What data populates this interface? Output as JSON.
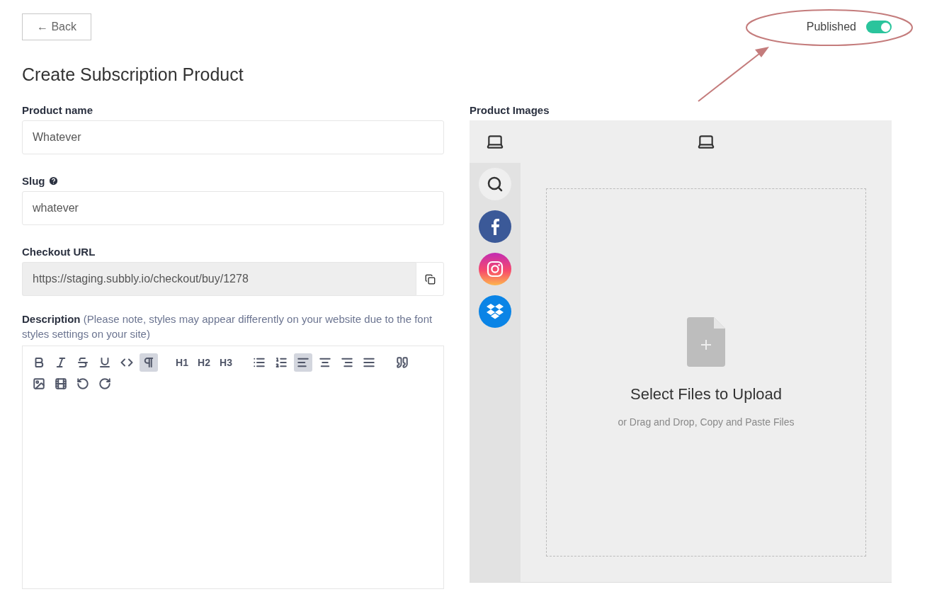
{
  "back_button": {
    "label": "← Back"
  },
  "published": {
    "label": "Published",
    "on": true
  },
  "title": "Create Subscription Product",
  "fields": [
    {
      "label": "Product name",
      "value": "Whatever",
      "help": false,
      "readonly": false
    },
    {
      "label": "Slug",
      "value": "whatever",
      "help": true,
      "readonly": false
    },
    {
      "label": "Checkout URL",
      "value": "https://staging.subbly.io/checkout/buy/1278",
      "help": false,
      "readonly": true
    }
  ],
  "description": {
    "label": "Description",
    "note": "(Please note, styles may appear differently on your website due to the font styles settings on your site)",
    "toolbar": [
      {
        "kind": "bold",
        "selected": false
      },
      {
        "kind": "italic",
        "selected": false
      },
      {
        "kind": "strike",
        "selected": false
      },
      {
        "kind": "underline",
        "selected": false
      },
      {
        "kind": "code",
        "selected": false
      },
      {
        "kind": "paragraph",
        "selected": true
      },
      {
        "kind": "gap"
      },
      {
        "kind": "text",
        "label": "H1",
        "selected": false
      },
      {
        "kind": "text",
        "label": "H2",
        "selected": false
      },
      {
        "kind": "text",
        "label": "H3",
        "selected": false
      },
      {
        "kind": "gap"
      },
      {
        "kind": "bullets",
        "selected": false
      },
      {
        "kind": "numbers",
        "selected": false
      },
      {
        "kind": "align-left",
        "selected": true
      },
      {
        "kind": "align-center",
        "selected": false
      },
      {
        "kind": "align-right",
        "selected": false
      },
      {
        "kind": "justify",
        "selected": false
      },
      {
        "kind": "gap"
      },
      {
        "kind": "quote",
        "selected": false
      },
      {
        "kind": "break"
      },
      {
        "kind": "image",
        "selected": false
      },
      {
        "kind": "video",
        "selected": false
      },
      {
        "kind": "undo",
        "selected": false
      },
      {
        "kind": "redo",
        "selected": false
      }
    ]
  },
  "images": {
    "label": "Product Images",
    "sources": [
      {
        "kind": "search",
        "selected": true
      },
      {
        "kind": "facebook",
        "selected": false
      },
      {
        "kind": "instagram",
        "selected": false
      },
      {
        "kind": "dropbox",
        "selected": false
      }
    ],
    "drop_title": "Select Files to Upload",
    "drop_hint": "or Drag and Drop, Copy and Paste Files"
  }
}
